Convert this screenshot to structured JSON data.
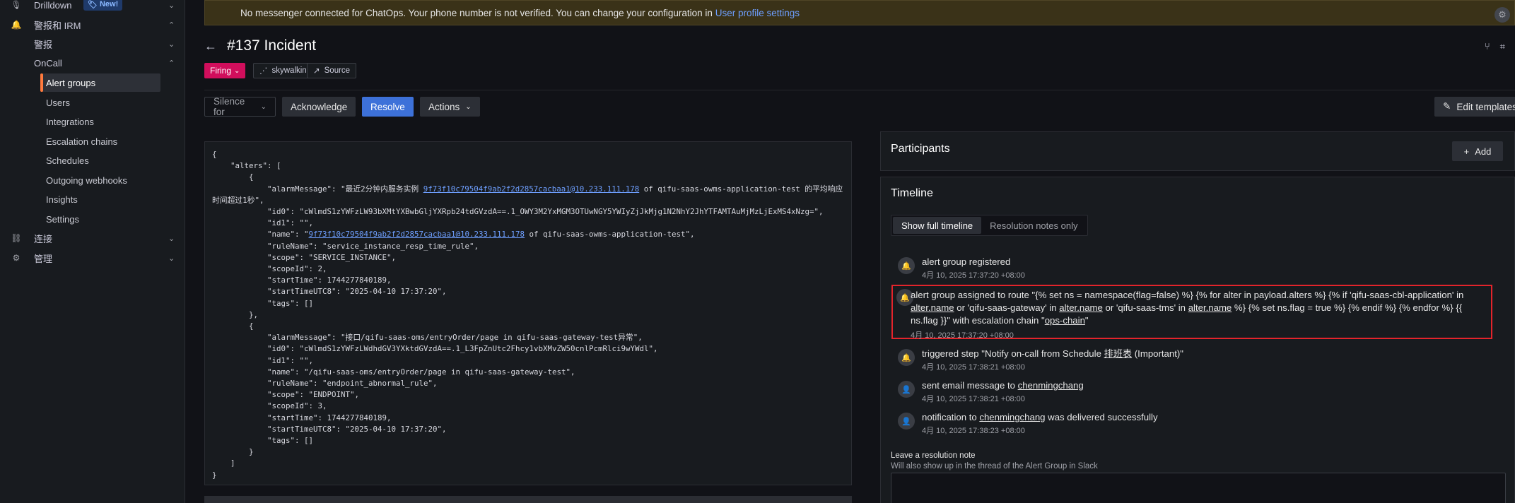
{
  "sidebar": {
    "drilldown": "Drilldown",
    "new_badge": "New!",
    "alerts_irm": "警报和 IRM",
    "alerting": "警报",
    "oncall": "OnCall",
    "items": [
      "Alert groups",
      "Users",
      "Integrations",
      "Escalation chains",
      "Schedules",
      "Outgoing webhooks",
      "Insights",
      "Settings"
    ],
    "connections": "连接",
    "admin": "管理"
  },
  "banner": {
    "text": "No messenger connected for ChatOps. Your phone number is not verified. You can change your configuration in",
    "link": "User profile settings"
  },
  "incident": {
    "title": "#137 Incident",
    "status": "Firing",
    "integration": "skywalking",
    "source": "Source"
  },
  "toolbar": {
    "silence_placeholder": "Silence for",
    "acknowledge": "Acknowledge",
    "resolve": "Resolve",
    "actions": "Actions",
    "edit_templates": "Edit templates"
  },
  "payload": {
    "l1": "{",
    "l2": "    \"alters\": [",
    "l3": "        {",
    "a1_msg_pre": "            \"alarmMessage\": \"最近2分钟内服务实例 ",
    "a1_msg_link": "9f73f10c79504f9ab2f2d2857cacbaa1@10.233.111.178",
    "a1_msg_post": " of qifu-saas-owms-application-test 的平均响应时间超过1秒\",",
    "a1_id0": "            \"id0\": \"cWlmdS1zYWFzLW93bXMtYXBwbGljYXRpb24tdGVzdA==.1_OWY3M2YxMGM3OTUwNGY5YWIyZjJkMjg1N2NhY2JhYTFAMTAuMjMzLjExMS4xNzg=\",",
    "a1_id1": "            \"id1\": \"\",",
    "a1_name_pre": "            \"name\": \"",
    "a1_name_link": "9f73f10c79504f9ab2f2d2857cacbaa1@10.233.111.178",
    "a1_name_post": " of qifu-saas-owms-application-test\",",
    "a1_rule": "            \"ruleName\": \"service_instance_resp_time_rule\",",
    "a1_scope": "            \"scope\": \"SERVICE_INSTANCE\",",
    "a1_scopeid": "            \"scopeId\": 2,",
    "a1_start": "            \"startTime\": 1744277840189,",
    "a1_startutc": "            \"startTimeUTC8\": \"2025-04-10 17:37:20\",",
    "a1_tags": "            \"tags\": []",
    "l4": "        },",
    "l5": "        {",
    "a2_msg": "            \"alarmMessage\": \"接口/qifu-saas-oms/entryOrder/page in qifu-saas-gateway-test异常\",",
    "a2_id0": "            \"id0\": \"cWlmdS1zYWFzLWdhdGV3YXktdGVzdA==.1_L3FpZnUtc2Fhcy1vbXMvZW50cnlPcmRlci9wYWdl\",",
    "a2_id1": "            \"id1\": \"\",",
    "a2_name": "            \"name\": \"/qifu-saas-oms/entryOrder/page in qifu-saas-gateway-test\",",
    "a2_rule": "            \"ruleName\": \"endpoint_abnormal_rule\",",
    "a2_scope": "            \"scope\": \"ENDPOINT\",",
    "a2_scopeid": "            \"scopeId\": 3,",
    "a2_start": "            \"startTime\": 1744277840189,",
    "a2_startutc": "            \"startTimeUTC8\": \"2025-04-10 17:37:20\",",
    "a2_tags": "            \"tags\": []",
    "l6": "        }",
    "l7": "    ]",
    "l8": "}"
  },
  "participants": {
    "title": "Participants",
    "add": "Add"
  },
  "timeline": {
    "title": "Timeline",
    "tab_full": "Show full timeline",
    "tab_notes": "Resolution notes only",
    "e1": {
      "text": "alert group registered",
      "time": "4月 10, 2025 17:37:20 +08:00"
    },
    "e2": {
      "p1": "alert group assigned to route \"{% set ns = namespace(flag=false) %} {% for alter in payload.alters %} {% if 'qifu-saas-cbl-application' in ",
      "u1": "alter.name",
      "p2": " or 'qifu-saas-gateway' in ",
      "u2": "alter.name",
      "p3": " or 'qifu-saas-tms' in ",
      "u3": "alter.name",
      "p4": " %} {% set ns.flag = true %} {% endif %} {% endfor %} {{ ns.flag }}\" with escalation chain \"",
      "u4": "ops-chain",
      "p5": "\"",
      "time": "4月 10, 2025 17:37:20 +08:00"
    },
    "e3": {
      "pre": "triggered step \"Notify on-call from Schedule ",
      "link": "排班表",
      "post": " (Important)\"",
      "time": "4月 10, 2025 17:38:21 +08:00"
    },
    "e4": {
      "pre": "sent email message to ",
      "link": "chenmingchang",
      "time": "4月 10, 2025 17:38:21 +08:00"
    },
    "e5": {
      "pre": "notification to ",
      "link": "chenmingchang",
      "post": " was delivered successfully",
      "time": "4月 10, 2025 17:38:23 +08:00"
    },
    "note_label": "Leave a resolution note",
    "note_help": "Will also show up in the thread of the Alert Group in Slack"
  }
}
